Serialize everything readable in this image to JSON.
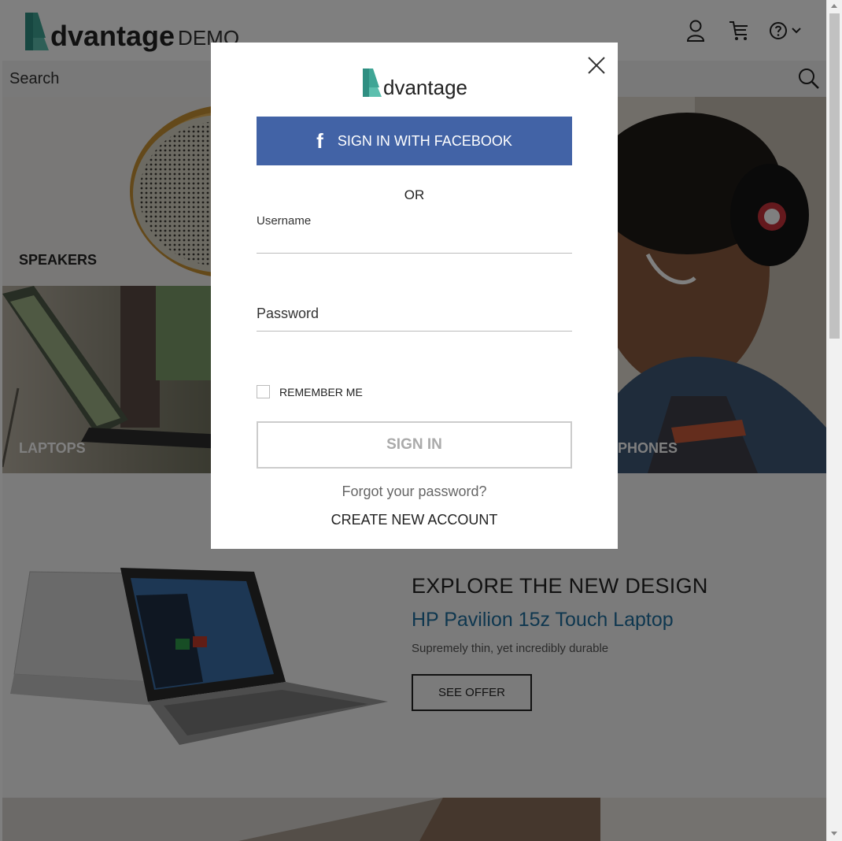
{
  "header": {
    "logo_text": "dvantage",
    "logo_suffix": "DEMO",
    "icons": [
      "user-icon",
      "cart-icon",
      "help-icon",
      "chevron-down-icon"
    ]
  },
  "search": {
    "placeholder": "Search",
    "icon": "search-icon"
  },
  "categories": [
    {
      "label": "SPEAKERS"
    },
    {
      "label": "LAPTOPS"
    },
    {
      "label": "HEADPHONES",
      "visible_label": "PHONES"
    }
  ],
  "promo": {
    "title": "EXPLORE THE NEW DESIGN",
    "subtitle": "HP Pavilion 15z Touch Laptop",
    "description": "Supremely thin, yet incredibly durable",
    "button": "SEE OFFER"
  },
  "modal": {
    "logo_text": "dvantage",
    "facebook_button": "SIGN IN WITH FACEBOOK",
    "facebook_icon": "facebook-icon",
    "or_text": "OR",
    "username_label": "Username",
    "password_label": "Password",
    "remember_me": "REMEMBER ME",
    "sign_in": "SIGN IN",
    "forgot_password": "Forgot your password?",
    "create_account": "CREATE NEW ACCOUNT"
  },
  "colors": {
    "brand_teal": "#4fa89a",
    "facebook_blue": "#4263a6",
    "promo_blue": "#1e6f9f"
  }
}
